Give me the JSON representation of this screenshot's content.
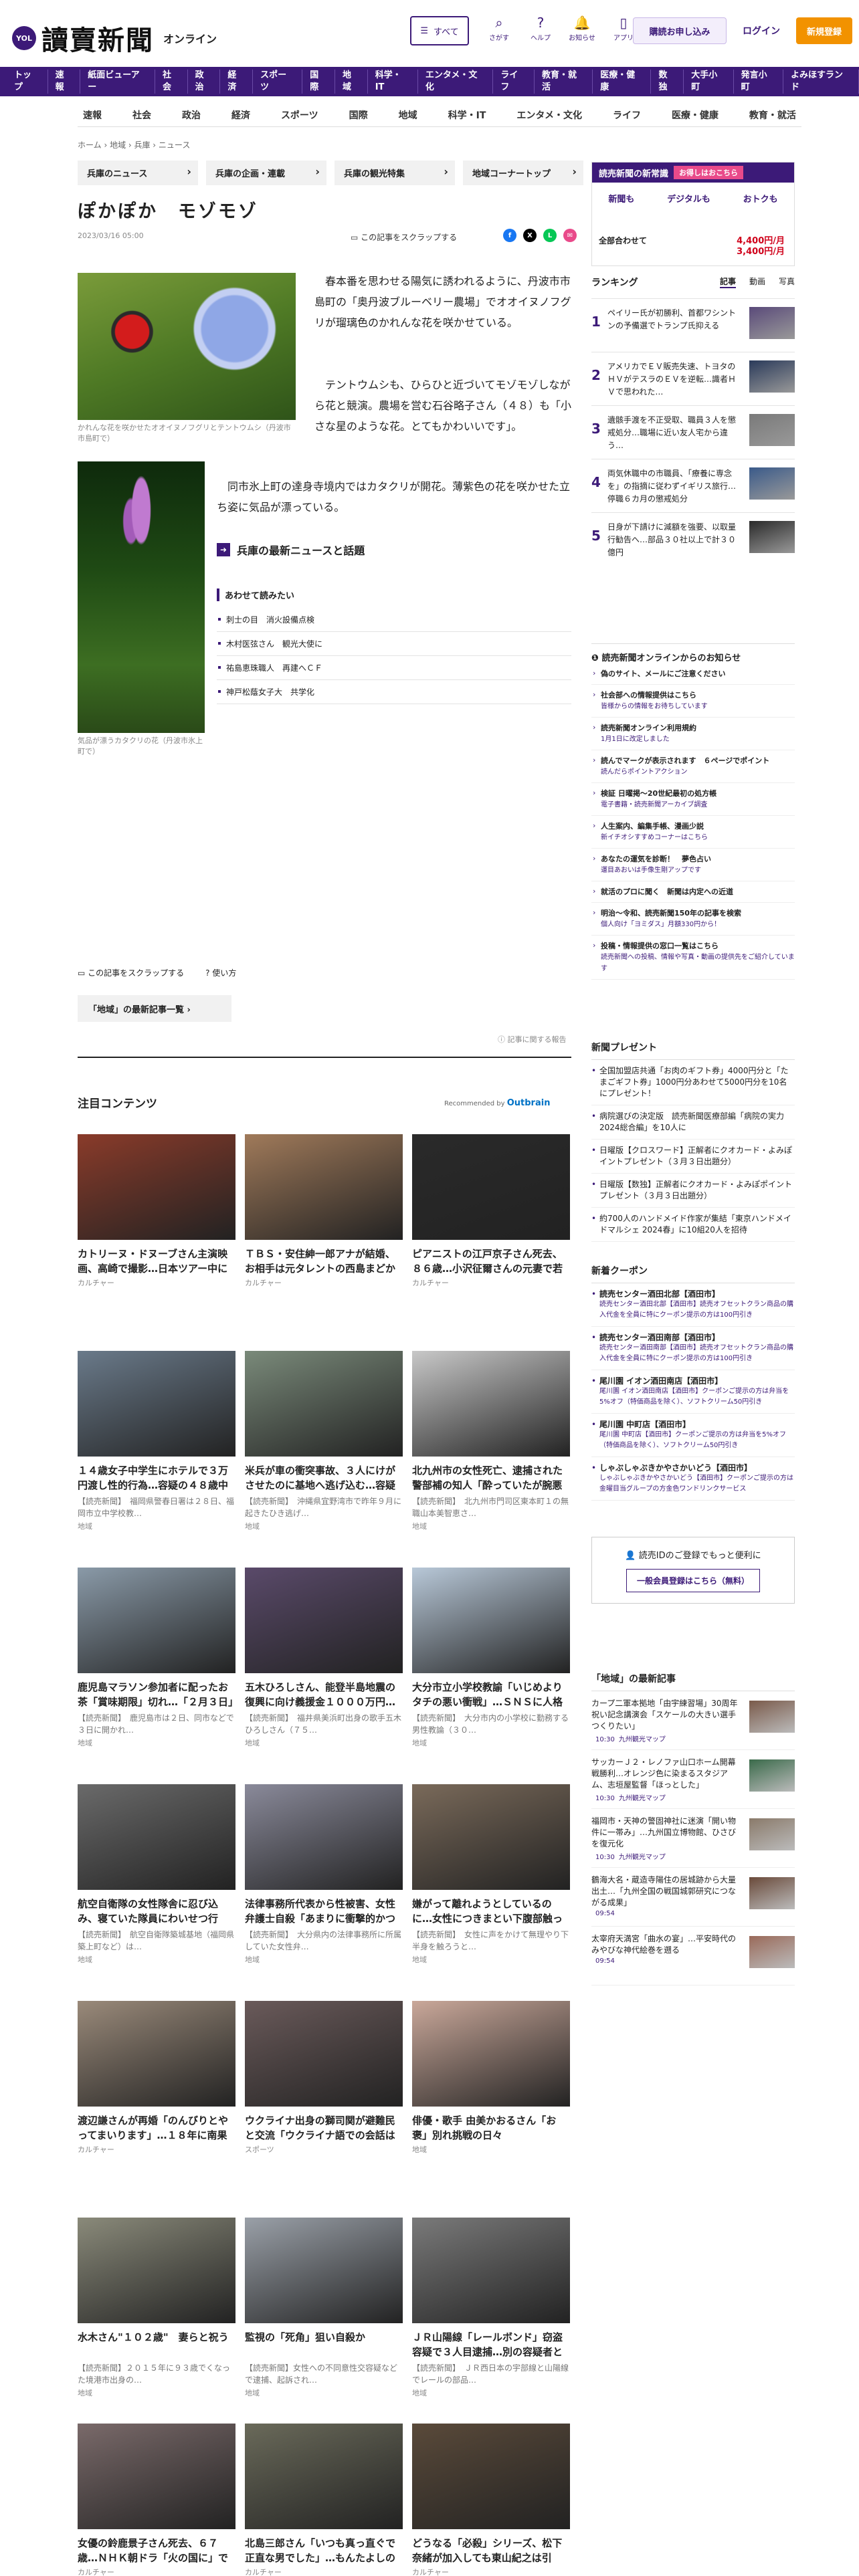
{
  "header": {
    "logo_mark": "YOL",
    "logo_text": "讀賣新聞",
    "logo_sub": "オンライン",
    "menu_label": "すべて",
    "icons": [
      {
        "label": "さがす",
        "icon": "search-icon",
        "glyph": "⌕"
      },
      {
        "label": "ヘルプ",
        "icon": "help-icon",
        "glyph": "?"
      },
      {
        "label": "お知らせ",
        "icon": "bell-icon",
        "glyph": "🔔"
      },
      {
        "label": "アプリ",
        "icon": "app-icon",
        "glyph": "▯"
      }
    ],
    "subscribe": "購読お申し込み",
    "login": "ログイン",
    "register": "新規登録"
  },
  "nav": [
    "トップ",
    "速報",
    "紙面ビューアー",
    "社会",
    "政治",
    "経済",
    "スポーツ",
    "国際",
    "地域",
    "科学・IT",
    "エンタメ・文化",
    "ライフ",
    "教育・就活",
    "医療・健康",
    "数独",
    "大手小町",
    "発言小町",
    "よみほすランド"
  ],
  "subnav": [
    "速報",
    "社会",
    "政治",
    "経済",
    "スポーツ",
    "国際",
    "地域",
    "科学・IT",
    "エンタメ・文化",
    "ライフ",
    "医療・健康",
    "教育・就活"
  ],
  "breadcrumb": "ホーム › 地域 › 兵庫 › ニュース",
  "tags": [
    "兵庫のニュース",
    "兵庫の企画・連載",
    "兵庫の観光特集",
    "地域コーナートップ"
  ],
  "article": {
    "title": "ぽかぽか　モゾモゾ",
    "date": "2023/03/16 05:00",
    "scrap": "この記事をスクラップする",
    "caption1": "かれんな花を咲かせたオオイヌノフグリとテントウムシ（丹波市市島町で）",
    "p1": "　春本番を思わせる陽気に誘われるように、丹波市市島町の「奥丹波ブルーベリー農場」でオオイヌノフグリが瑠璃色のかれんな花を咲かせている。",
    "p2": "　テントウムシも、ひらひと近づいてモゾモゾしながら花と競演。農場を営む石谷略子さん（４８）も「小さな星のような花。とてもかわいいです」。",
    "caption2": "気品が漂うカタクリの花（丹波市氷上町で）",
    "p3": "　同市氷上町の達身寺境内ではカタクリが開花。薄紫色の花を咲かせた立ち姿に気品が漂っている。",
    "news_link": "兵庫の最新ニュースと話題",
    "read_head": "あわせて読みたい",
    "read_items": [
      "刺士の目　消火設備点検",
      "木村医弦さん　観光大使に",
      "祐島恵珠職人　再建へＣＦ",
      "神戸松蔭女子大　共学化"
    ],
    "foot_scrap": "この記事をスクラップする",
    "foot_howto": "使い方",
    "region_btn": "「地域」の最新記事一覧 ›",
    "report": "記事に関する報告"
  },
  "attention": {
    "title": "注目コンテンツ",
    "recommended": "Recommended by",
    "brand": "Outbrain"
  },
  "cards": [
    {
      "t": "カトリーヌ・ドヌーブさん主演映画、高崎で撮影…日本ツアー中に突然亡くなった…",
      "d": "",
      "c": "カルチャー",
      "bg": "#8a3b2a"
    },
    {
      "t": "ＴＢＳ・安住紳一郎アナが結婚、お相手は元タレントの西島まどかさん",
      "d": "",
      "c": "カルチャー",
      "bg": "#a07a5a"
    },
    {
      "t": "ピアニストの江戸京子さん死去、８６歳…小沢征爾さんの元妻で若手音楽家の…",
      "d": "",
      "c": "カルチャー",
      "bg": "#2a2a2a"
    },
    {
      "t": "１４歳女子中学生にホテルで３万円渡し性的行為…容疑の４８歳中学教諭「興…",
      "d": "【読売新聞】　福岡県警春日署は２８日、福岡市立中学校教…",
      "c": "地域",
      "bg": "#6a7a8a"
    },
    {
      "t": "米兵が車の衝突事故、３人にけがさせたのに基地へ逃げ込む…容疑で書類送検",
      "d": "【読売新聞】　沖縄県宜野湾市で昨年９月に起きたひき逃げ…",
      "c": "地域",
      "bg": "#7a8a7a"
    },
    {
      "t": "北九州市の女性死亡、逮捕された警部補の知人「酔っていたが腕悪な雰囲気で…",
      "d": "【読売新聞】　北九州市門司区東本町１の無職山本美智恵さ…",
      "c": "地域",
      "bg": "#c8c8c8"
    },
    {
      "t": "鹿児島マラソン参加者に配ったお茶「賞味期限」切れ…「２月３日」の紙パ…",
      "d": "【読売新聞】　鹿児島市は２日、同市などで３日に開かれ…",
      "c": "地域",
      "bg": "#8a9aa8"
    },
    {
      "t": "五木ひろしさん、能登半島地震の復興に向け義援金１０００万円…「古里へ…",
      "d": "【読売新聞】　福井県美浜町出身の歌手五木ひろしさん（７５…",
      "c": "地域",
      "bg": "#5a4a6a"
    },
    {
      "t": "大分市立小学校教諭「いじめよりタチの悪い衝戦」…ＳＮＳに人格否定するよう…",
      "d": "【読売新聞】　大分市内の小学校に勤務する男性教論（３０…",
      "c": "地域",
      "bg": "#b8c8d8"
    },
    {
      "t": "航空自衛隊の女性隊舎に忍び込み、寝ていた隊員にわいせつ行為…３等空尉を…",
      "d": "【読売新聞】　航空自衛隊築城基地（福岡県築上町など）は…",
      "c": "地域",
      "bg": "#6a6a6a"
    },
    {
      "t": "法律事務所代表から性被害、女性弁護士自殺「あまりに衝撃的かつ屈辱的」…",
      "d": "【読売新聞】　大分県内の法律事務所に所属していた女性弁…",
      "c": "地域",
      "bg": "#8a8a9a"
    },
    {
      "t": "嫌がって離れようとしているのに…女性につきまとい下腹部触った中学教諭…",
      "d": "【読売新聞】　女性に声をかけて無理やり下半身を触ろうと…",
      "c": "地域",
      "bg": "#7a6a5a"
    },
    {
      "t": "渡辺謙さんが再婚「のんびりとやってまいります」…１８年に南果歩さんと離婚",
      "d": "",
      "c": "カルチャー",
      "bg": "#9a8a7a"
    },
    {
      "t": "ウクライナ出身の獅司関が避難民と交流「ウクライナ語での会話は久しぶり、…",
      "d": "",
      "c": "スポーツ",
      "bg": "#6a5a5a"
    },
    {
      "t": "俳優・歌手 由美かおるさん「お褒」別れ挑戦の日々",
      "d": "",
      "c": "地域",
      "bg": "#caa89a"
    },
    {
      "t": "水木さん\"１０２歳\"　妻らと祝う",
      "d": "【読売新聞】２０１５年に９３歳でくなった境港市出身の…",
      "c": "地域",
      "bg": "#8a8a7a"
    },
    {
      "t": "監視の「死角」狙い自殺か",
      "d": "【読売新聞】女性への不同意性交容疑などで逮捕、起訴され…",
      "c": "地域",
      "bg": "#9aa0a8"
    },
    {
      "t": "ＪＲ山陽線「レールボンド」窃盗容疑で３人目逮捕…別の容疑者と共謀、…",
      "d": "【読売新聞】　ＪＲ西日本の宇部線と山陽線でレールの部品…",
      "c": "地域",
      "bg": "#7a7a7a"
    },
    {
      "t": "女優の鈴鹿景子さん死去、６７歳…ＮＨＫ朝ドラ「火の国に」でヒロイン",
      "d": "",
      "c": "カルチャー",
      "bg": "#7a6a6a"
    },
    {
      "t": "北島三郎さん「いつも真っ直ぐで正直な男でした」…もんたよしのりさん、事…",
      "d": "",
      "c": "カルチャー",
      "bg": "#6a6a5a"
    },
    {
      "t": "どうなる「必殺」シリーズ、松下奈緒が加入しても東山紀之は引退…自宅に…",
      "d": "",
      "c": "カルチャー",
      "bg": "#5a4a3a"
    }
  ],
  "sidebar": {
    "promo_head": "読売新聞の新常識",
    "promo_badge": "お得しはおこちら",
    "promo_items": [
      "新聞も",
      "デジタルも",
      "おトクも"
    ],
    "promo_price": "全部合わせて",
    "price1": "4,400円/月",
    "price2": "3,400円/月",
    "rank_title": "ランキング",
    "rank_tabs": [
      "記事",
      "動画",
      "写真"
    ],
    "ranks": [
      {
        "n": "1",
        "t": "ペイリー氏が初勝利、首都ワシントンの予備選でトランプ氏抑える"
      },
      {
        "n": "2",
        "t": "アメリカでＥＶ販売失速、トヨタのＨＶがテスラのＥＶを逆転…識者ＨＶで思われた…"
      },
      {
        "n": "3",
        "t": "遺骸手渡を不正受取、職員３人を懲戒処分…職場に近い友人宅から違う…"
      },
      {
        "n": "4",
        "t": "両気休職中の市職員、「療養に専念を」の指摘に従わずイギリス旅行…停職６カ月の懲戒処分"
      },
      {
        "n": "5",
        "t": "日身が下請けに減額を強要、以取量行勧告へ…部品３０社以上で計３０億円"
      }
    ],
    "info_head": "読売新聞オンラインからのお知らせ",
    "info": [
      {
        "t": "偽のサイト、メールにご注意ください",
        "s": ""
      },
      {
        "t": "社会部への情報提供はこちら",
        "s": "皆様からの情報をお待ちしています"
      },
      {
        "t": "読売新聞オンライン利用規約",
        "s": "1月1日に改定しました"
      },
      {
        "t": "読んでマークが表示されます　６ページでポイント",
        "s": "読んだらポイントアクション"
      },
      {
        "t": "検証 日曜掲〜20世紀最初の処方帳",
        "s": "電子書籍・読売新聞アーカイブ調査"
      },
      {
        "t": "人生案内、編集手帳、漫画少説",
        "s": "新イチオシすすめコーナーはこちら"
      },
      {
        "t": "あなたの運気を診断！　夢色占い",
        "s": "運目あおいは手像生剛アップです"
      },
      {
        "t": "就活のプロに聞く　新聞は内定への近道",
        "s": ""
      },
      {
        "t": "明治〜令和、読売新聞150年の記事を検索",
        "s": "個人向け「ヨミダス」月額330円から！"
      },
      {
        "t": "投稿・情報提供の窓口一覧はこちら",
        "s": "読売新聞への投稿、情報や写真・動画の提供先をご紹介しています"
      }
    ],
    "present_title": "新聞プレゼント",
    "present": [
      "全国加盟店共通「お肉のギフト券」4000円分と「たまごギフト券」1000円分あわせて5000円分を10名にプレゼント！",
      "病院選びの決定版　読売新聞医療部編「病院の実力2024総合編」を10人に",
      "日曜版【クロスワード】正解者にクオカード・よみぽイントプレゼント（３月３日出題分）",
      "日曜版【数独】正解者にクオカード・よみぽポイントプレゼント（３月３日出題分）",
      "約700人のハンドメイド作家が集結「東京ハンドメイドマルシェ 2024春」に10組20人を招待"
    ],
    "coupon_title": "新着クーポン",
    "coupons": [
      {
        "t": "読売センター酒田北部【酒田市】",
        "s": "読売センター酒田北部【酒田市】読売オフセットクラン商品の購入代金を全員に特にクーポン提示の方は100円引き"
      },
      {
        "t": "読売センター酒田南部【酒田市】",
        "s": "読売センター酒田南部【酒田市】読売オフセットクラン商品の購入代金を全員に特にクーポン提示の方は100円引き"
      },
      {
        "t": "尾川園 イオン酒田南店【酒田市】",
        "s": "尾川園 イオン酒田南店【酒田市】クーポンご提示の方は弁当を5%オフ（特価商品を除く）、ソフトクリーム50円引き"
      },
      {
        "t": "尾川園 中町店【酒田市】",
        "s": "尾川園 中町店【酒田市】クーポンご提示の方は弁当を5%オフ（特価商品を除く）、ソフトクリーム50円引き"
      },
      {
        "t": "しゃぶしゃぶきかやさかいどう【酒田市】",
        "s": "しゃぶしゃぶきかやさかいどう【酒田市】クーポンご提示の方は金曜目当グループの方金色ワンドリンクサービス"
      }
    ],
    "reg_text": "読売IDのご登録でもっと便利に",
    "reg_btn": "一般会員登録はこちら（無料）",
    "local_title": "「地域」の最新記事",
    "locals": [
      {
        "t": "カープ二軍本拠地「由宇練習場」30周年祝い記念講演会「スケールの大きい選手つくりたい」",
        "time": "10:30",
        "src": "九州観光マップ"
      },
      {
        "t": "サッカーＪ２・レノファ山口ホーム開幕戦勝利…オレンジ色に染まるスタジアム、志垣屋監督「ほっとした」",
        "time": "10:30",
        "src": "九州観光マップ"
      },
      {
        "t": "福岡市・天神の警固神社に迷演「開い物件に一帯み」…九州国立博物館、ひさびを復元化",
        "time": "10:30",
        "src": "九州観光マップ"
      },
      {
        "t": "鶴海大名・蔵造寺陽住の居城跡から大量出土…「九州全国の戦国城郭研究につながる成果」",
        "time": "09:54",
        "src": ""
      },
      {
        "t": "太宰府天満宮「曲水の宴」…平安時代のみやびな神代絵巻を遡る",
        "time": "09:54",
        "src": ""
      }
    ]
  }
}
